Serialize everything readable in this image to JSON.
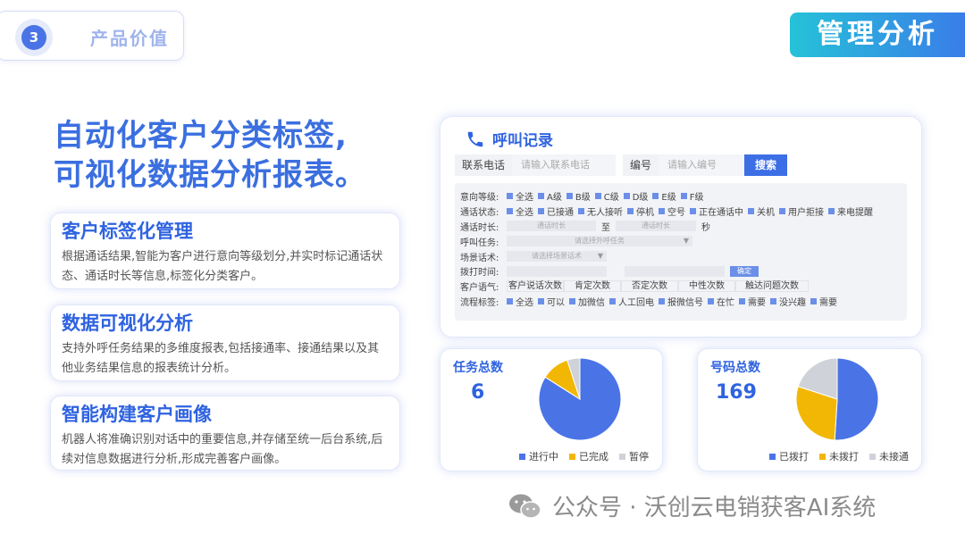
{
  "section": {
    "number": "3",
    "label": "产品价值"
  },
  "page_title": "管理分析",
  "headline": {
    "line1": "自动化客户分类标签,",
    "line2": "可视化数据分析报表。"
  },
  "features": [
    {
      "title": "客户标签化管理",
      "desc": "根据通话结果,智能为客户进行意向等级划分,并实时标记通话状态、通话时长等信息,标签化分类客户。"
    },
    {
      "title": "数据可视化分析",
      "desc": "支持外呼任务结果的多维度报表,包括接通率、接通结果以及其他业务结果信息的报表统计分析。"
    },
    {
      "title": "智能构建客户画像",
      "desc": "机器人将准确识别对话中的重要信息,并存储至统一后台系统,后续对信息数据进行分析,形成完善客户画像。"
    }
  ],
  "call_panel": {
    "title": "呼叫记录",
    "phone_label": "联系电话",
    "phone_placeholder": "请输入联系电话",
    "id_label": "编号",
    "id_placeholder": "请输入编号",
    "search_btn": "搜索",
    "filters": {
      "intent": {
        "name": "意向等级:",
        "options": [
          "全选",
          "A级",
          "B级",
          "C级",
          "D级",
          "E级",
          "F级"
        ]
      },
      "status": {
        "name": "通话状态:",
        "options": [
          "全选",
          "已接通",
          "无人接听",
          "停机",
          "空号",
          "正在通话中",
          "关机",
          "用户拒接",
          "来电提醒"
        ]
      },
      "duration": {
        "name": "通话时长:",
        "from": "通话时长",
        "to_label": "至",
        "to": "通话时长",
        "unit": "秒"
      },
      "task": {
        "name": "呼叫任务:",
        "placeholder": "请选择外呼任务",
        "arrow": "▼"
      },
      "script": {
        "name": "场景话术:",
        "placeholder": "请选择场景话术",
        "arrow": "▼"
      },
      "dial_time": {
        "name": "拨打时间:",
        "confirm": "确定"
      },
      "tone": {
        "name": "客户语气:",
        "cells": [
          "客户说话次数",
          "肯定次数",
          "否定次数",
          "中性次数",
          "触达问题次数"
        ]
      },
      "flow_tags": {
        "name": "流程标签:",
        "options": [
          "全选",
          "可以",
          "加微信",
          "人工回电",
          "报微信号",
          "在忙",
          "需要",
          "没兴趣",
          "需要"
        ]
      }
    }
  },
  "task_card": {
    "label": "任务总数",
    "value": "6",
    "legend": [
      "进行中",
      "已完成",
      "暂停"
    ]
  },
  "number_card": {
    "label": "号码总数",
    "value": "169",
    "legend": [
      "已拨打",
      "未拨打",
      "未接通"
    ]
  },
  "chart_data": [
    {
      "type": "pie",
      "title": "任务总数",
      "categories": [
        "进行中",
        "已完成",
        "暂停"
      ],
      "values": [
        84,
        11,
        5
      ],
      "colors": [
        "#4a74e6",
        "#f2b705",
        "#cfd2d8"
      ]
    },
    {
      "type": "pie",
      "title": "号码总数",
      "categories": [
        "已拨打",
        "未拨打",
        "未接通"
      ],
      "values": [
        51,
        29,
        20
      ],
      "colors": [
        "#4a74e6",
        "#f2b705",
        "#cfd2d8"
      ]
    }
  ],
  "watermark": "公众号 · 沃创云电销获客AI系统",
  "icons": {
    "phone": "phone-icon",
    "wechat": "wechat-icon"
  }
}
